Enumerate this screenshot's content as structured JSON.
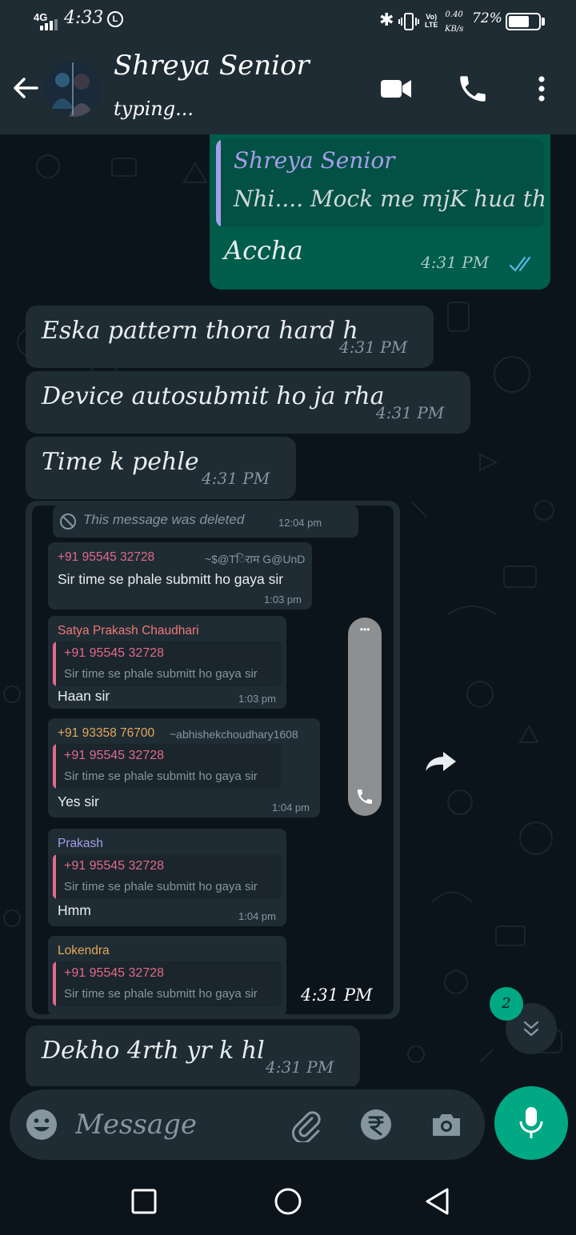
{
  "status_bar": {
    "network": "4G",
    "time": "4:33",
    "notif_badge": "L",
    "volte": [
      "Vo)",
      "LTE"
    ],
    "data_speed": [
      "0.40",
      "KB/s"
    ],
    "battery": "72%",
    "battery_level": 0.72
  },
  "header": {
    "contact_name": "Shreya Senior",
    "status": "typing..."
  },
  "messages": {
    "out1": {
      "quote_name": "Shreya Senior",
      "quote_text": "Nhi.... Mock me mjK hua tha",
      "text": "Accha",
      "time": "4:31 PM"
    },
    "in1": {
      "text": "Eska pattern thora hard h",
      "time": "4:31 PM"
    },
    "in2": {
      "text": "Device autosubmit ho ja rha",
      "time": "4:31 PM"
    },
    "in3": {
      "text": "Time k pehle",
      "time": "4:31 PM"
    },
    "image": {
      "time": "4:31 PM",
      "deleted": {
        "text": "This message was deleted",
        "time": "12:04 pm"
      },
      "msg1": {
        "name": "+91 95545 32728",
        "alias": "~$@Tिराम G@UnD",
        "text": "Sir time se phale  submitt ho gaya sir",
        "time": "1:03 pm"
      },
      "msg2": {
        "name": "Satya Prakash Chaudhari",
        "quote_name": "+91 95545 32728",
        "quote_text": "Sir time se phale  submitt ho gaya sir",
        "text": "Haan sir",
        "time": "1:03 pm"
      },
      "msg3": {
        "name": "+91 93358 76700",
        "alias": "~abhishekchoudhary1608",
        "quote_name": "+91 95545 32728",
        "quote_text": "Sir time se phale  submitt ho gaya sir",
        "text": "Yes sir",
        "time": "1:04 pm"
      },
      "msg4": {
        "name": "Prakash",
        "quote_name": "+91 95545 32728",
        "quote_text": "Sir time se phale  submitt ho gaya sir",
        "text": "Hmm",
        "time": "1:04 pm"
      },
      "msg5": {
        "name": "Lokendra",
        "quote_name": "+91 95545 32728",
        "quote_text": "Sir time se phale  submitt ho gaya sir"
      },
      "scroll_dots": "•••"
    },
    "in4": {
      "text": "Dekho 4rth yr k hl",
      "time": "4:31 PM"
    }
  },
  "unread_count": "2",
  "composer": {
    "placeholder": "Message"
  },
  "colors": {
    "header_bg": "#1f2c34",
    "chat_bg": "#0b141a",
    "outgoing_bubble": "#005c4b",
    "incoming_bubble": "#1f2c34",
    "accent_green": "#00a884",
    "read_ticks": "#53bdeb",
    "quote_name": "#a79dea"
  },
  "icons": {
    "back": "arrow-left-icon",
    "video": "video-call-icon",
    "call": "phone-icon",
    "menu": "more-vert-icon",
    "emoji": "emoji-icon",
    "attach": "paperclip-icon",
    "payment": "rupee-icon",
    "camera": "camera-icon",
    "mic": "mic-icon",
    "forward": "forward-icon",
    "scroll_down": "chevron-double-down-icon"
  }
}
